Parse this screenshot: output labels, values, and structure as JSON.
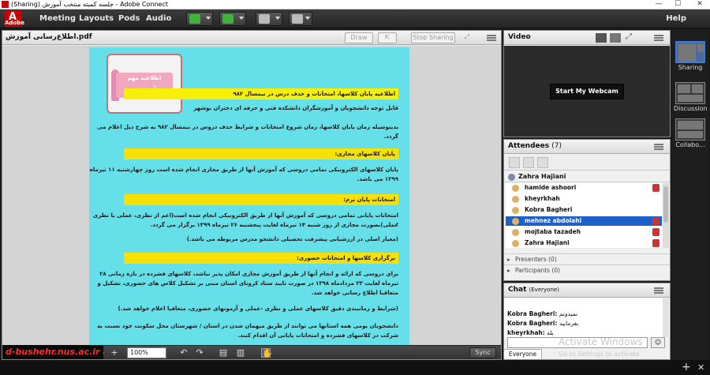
{
  "window": {
    "title": "(Sharing) جلسه کمیته منتخب آموزش - Adobe Connect",
    "minimize": "—",
    "maximize": "☐",
    "close": "✕"
  },
  "menu": {
    "items": [
      "Meeting",
      "Layouts",
      "Pods",
      "Audio"
    ],
    "help": "Help",
    "adobe_label": "Adobe"
  },
  "share_pod": {
    "file_name": "اطلاع‌رسانی آموزش.pdf",
    "draw_label": "Draw",
    "stop_sharing_label": "Stop Sharing",
    "footer": {
      "page_number": "1",
      "zoom_value": "100%",
      "sync_label": "Sync"
    },
    "url_badge": "d-bushehr.nus.ac.ir"
  },
  "document": {
    "notice_badge": "اطلاعیه مهم آموزشی",
    "lines": [
      {
        "text": "اطلاعیه پایان کلاسها، امتحانات و حذف درس در نیمسال ۹۸۲",
        "style": "hl"
      },
      {
        "text": "قابل توجه دانشجویان و آموزشگران دانشکده فنی و حرفه ای دختران بوشهر",
        "style": ""
      },
      {
        "text": "بدینوسیله زمان پایان کلاسها، زمان شروع امتحانات و شرایط حذف دروس در نیمسال ۹۸۲ به شرح ذیل اعلام می",
        "style": ""
      },
      {
        "text": "گردد.",
        "style": ""
      },
      {
        "text": "پایان کلاسهای مجازی:",
        "style": "hl2"
      },
      {
        "text": "پایان کلاسهای الکترونیکی تمامی دروسی که آموزش آنها از طریق مجازی انجام شده است روز چهارشنبه ۱۱ تیرماه",
        "style": ""
      },
      {
        "text": "۱۳۹۹ می باشد.",
        "style": ""
      },
      {
        "text": "امتحانات پایان ترم:",
        "style": "hl2"
      },
      {
        "text": "امتحانات پایانی تمامی دروسی که آموزش آنها از طریق الکترونیکی انجام شده است(اعم از نظری، عملی یا نظری -",
        "style": ""
      },
      {
        "text": "عملی)بصورت مجازی از روز شنبه ۱۴ تیرماه لغایت پنجشنبه ۲۶ تیرماه ۱۳۹۹ برگزار می گردد.",
        "style": ""
      },
      {
        "text": "(معیار اصلی در ارزشیابی پیشرفت تحصیلی دانشجو مدرس مربوطه می باشد.)",
        "style": ""
      },
      {
        "text": "برگزاری کلاسها و امتحانات حضوری:",
        "style": "hl2"
      },
      {
        "text": "برای دروسی که ارائه و انجام آنها از طریق آموزش مجازی امکان پذیر نباشد، کلاسهای فشرده در بازه زمانی ۲۸",
        "style": ""
      },
      {
        "text": "تیرماه لغایت ۲۳ مردادماه ۱۳۹۸ در صورت تایید ستاد کرونای استان مبنی بر تشکیل کلاس های حضوری، تشکیل و",
        "style": ""
      },
      {
        "text": "متعاقبا اطلاع رسانی خواهد شد.",
        "style": ""
      },
      {
        "text": "(شرایط و زمانبندی دقیق کلاسهای عملی و نظری -عملی و آزمونهای حضوری، متعاقبا اعلام خواهد شد.)",
        "style": ""
      },
      {
        "text": "دانشجویان بومی همه استانها می توانند از طریق میهمان شدن در استان / شهرستان محل سکونت خود نسبت به",
        "style": ""
      },
      {
        "text": "شرکت در کلاسهای فشرده و امتحانات پایانی آن اقدام کنند.",
        "style": ""
      },
      {
        "text": "(در غیر اینصورت این دروس بصورت ناتمام به ترم بعد منتقل می شود)",
        "style": ""
      }
    ]
  },
  "video_pod": {
    "title": "Video",
    "webcam_label": "Start My Webcam"
  },
  "attendees_pod": {
    "title": "Attendees",
    "count": "(7)",
    "host_name": "Zahra Hajiani",
    "attendees": [
      {
        "name": "hamide ashoori",
        "selected": false,
        "mic": true
      },
      {
        "name": "kheyrkhah",
        "selected": false,
        "mic": false
      },
      {
        "name": "Kobra Bagheri",
        "selected": false,
        "mic": false
      },
      {
        "name": "mehnez abdolahi",
        "selected": true,
        "mic": true
      },
      {
        "name": "mojtaba tazadeh",
        "selected": false,
        "mic": true
      },
      {
        "name": "Zahra Hajiani",
        "selected": false,
        "mic": true
      }
    ],
    "groups": [
      "Presenters (0)",
      "Participants (0)"
    ]
  },
  "chat_pod": {
    "title": "Chat",
    "scope": "(Everyone)",
    "messages": [
      {
        "author": "Kobra Bagheri:",
        "text": "نمیدونم"
      },
      {
        "author": "Kobra Bagheri:",
        "text": "بفرمایید"
      },
      {
        "author": "kheyrkhah:",
        "text": "بله"
      }
    ],
    "tab_label": "Everyone"
  },
  "watermark": {
    "line1": "Activate Windows",
    "line2": "Go to Settings to activate"
  },
  "layouts": [
    {
      "label": "Sharing",
      "active": true
    },
    {
      "label": "Discussion",
      "active": false
    },
    {
      "label": "Collabo...",
      "active": false
    }
  ],
  "colors": {
    "page_bg": "#66e0e8",
    "highlight": "#f8f000",
    "selection": "#1f5fc8",
    "url_text": "#ff2a2a"
  }
}
